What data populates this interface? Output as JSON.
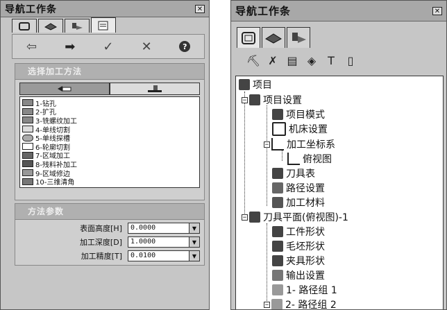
{
  "left_panel": {
    "title": "导航工作条",
    "close_label": "✕",
    "tabs": [
      {
        "icon": "square-outline-icon"
      },
      {
        "icon": "layer-icon"
      },
      {
        "icon": "tool-icon"
      },
      {
        "icon": "document-list-icon"
      }
    ],
    "toolbar": [
      {
        "icon": "arrow-left-icon",
        "glyph": "⇦"
      },
      {
        "icon": "arrow-right-icon",
        "glyph": "➡"
      },
      {
        "icon": "check-icon",
        "glyph": "✓"
      },
      {
        "icon": "cross-icon",
        "glyph": "✕"
      },
      {
        "icon": "help-icon",
        "glyph": "?"
      }
    ],
    "method_section": {
      "header": "选择加工方法",
      "methods": [
        "1-钻孔",
        "2-扩孔",
        "3-铣螺纹加工",
        "4-单线切割",
        "5-单线探槽",
        "6-轮廓切割",
        "7-区域加工",
        "8-残料补加工",
        "9-区域修边",
        "10-三维清角"
      ]
    },
    "params_section": {
      "header": "方法参数",
      "params": [
        {
          "label": "表面高度[H]",
          "value": "0.0000"
        },
        {
          "label": "加工深度[D]",
          "value": "1.0000"
        },
        {
          "label": "加工精度[T]",
          "value": "0.0100"
        }
      ]
    }
  },
  "right_panel": {
    "title": "导航工作条",
    "close_label": "✕",
    "toolbar_icons": [
      "drill-icon",
      "runner-icon",
      "table-icon",
      "tool-holder-icon",
      "tool-t-icon",
      "document-icon"
    ],
    "tree": [
      {
        "label": "项目",
        "icon": "project-icon"
      },
      {
        "label": "项目设置",
        "icon": "project-settings-icon"
      },
      {
        "label": "项目模式",
        "icon": "project-mode-icon"
      },
      {
        "label": "机床设置",
        "icon": "machine-icon"
      },
      {
        "label": "加工坐标系",
        "icon": "coordinate-icon"
      },
      {
        "label": "俯视图",
        "icon": "top-view-icon"
      },
      {
        "label": "刀具表",
        "icon": "tool-table-icon"
      },
      {
        "label": "路径设置",
        "icon": "path-settings-icon"
      },
      {
        "label": "加工材料",
        "icon": "material-icon"
      },
      {
        "label": "刀具平面(俯视图)-1",
        "icon": "tool-plane-icon"
      },
      {
        "label": "工件形状",
        "icon": "workpiece-icon"
      },
      {
        "label": "毛坯形状",
        "icon": "blank-icon"
      },
      {
        "label": "夹具形状",
        "icon": "fixture-icon"
      },
      {
        "label": "输出设置",
        "icon": "output-icon"
      },
      {
        "label": "1- 路径组 1",
        "icon": "folder-icon"
      },
      {
        "label": "2- 路径组 2",
        "icon": "folder-icon"
      }
    ]
  }
}
